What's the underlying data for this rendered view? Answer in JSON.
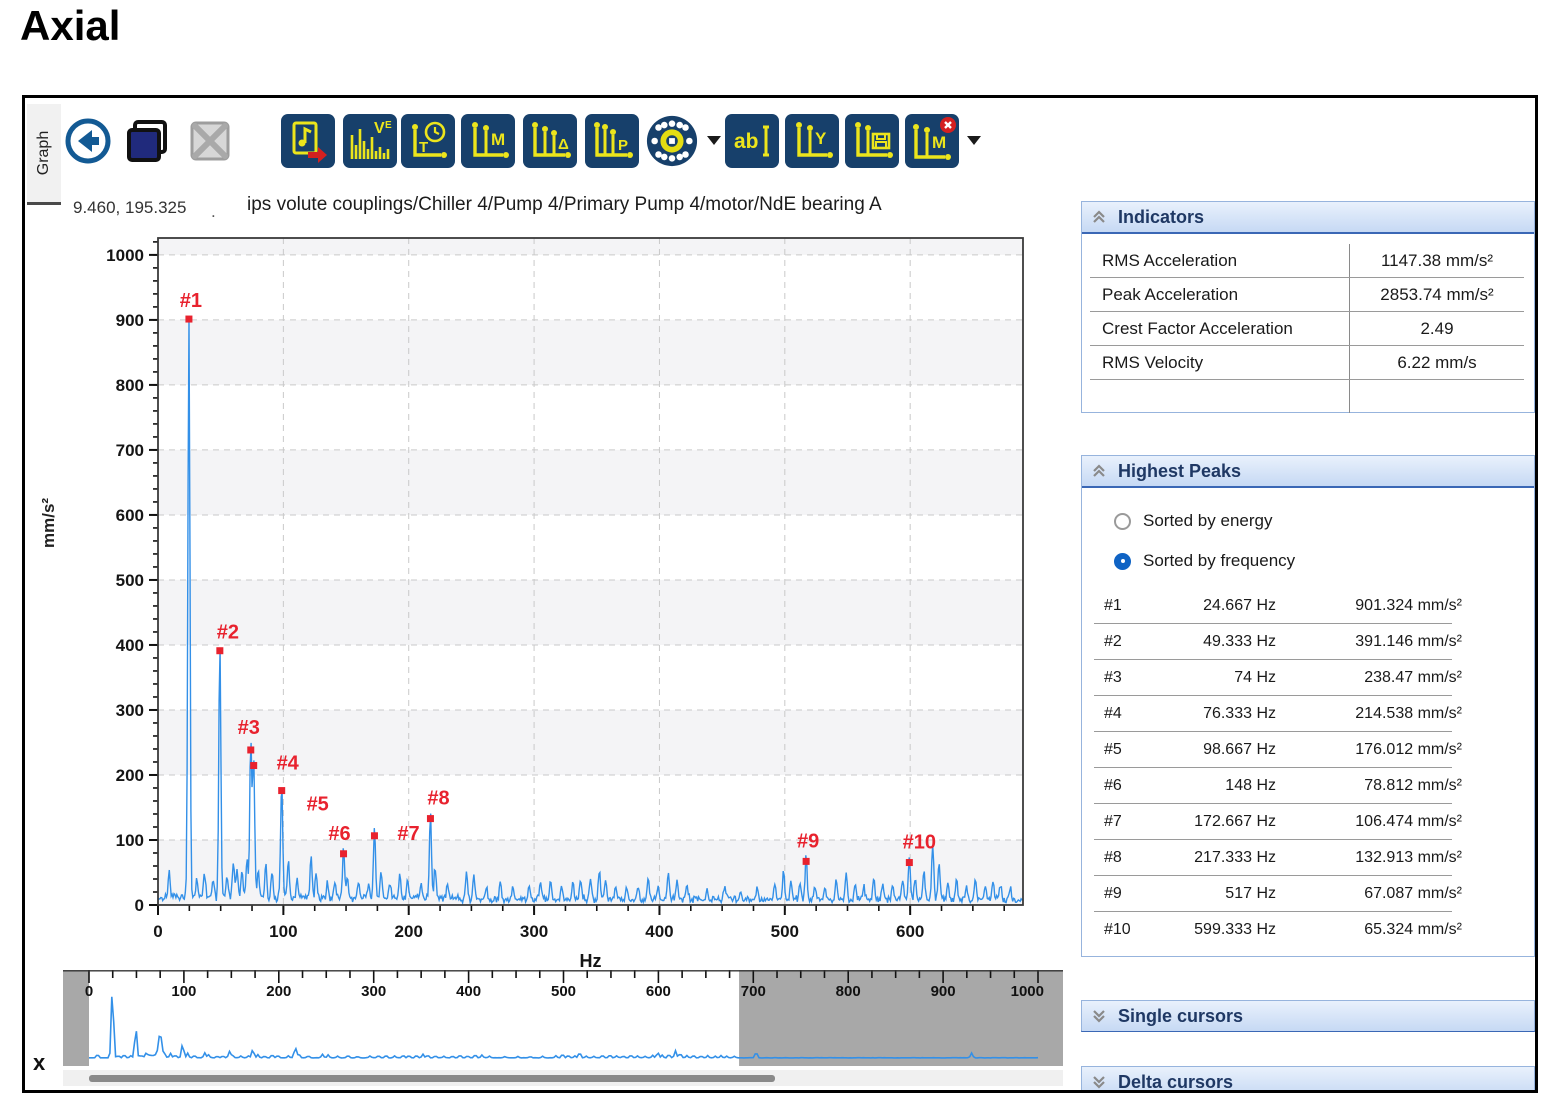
{
  "page_title": "Axial",
  "tab_label": "Graph",
  "toolbar": {
    "glyphs": {
      "ve": "V",
      "ve_sup": "E",
      "t": "T",
      "m": "M",
      "delta": "Δ",
      "p": "P",
      "ab": "ab",
      "y": "Y",
      "mx": "M"
    }
  },
  "readout": {
    "coordinates": "9.460, 195.325",
    "truncation_dot": ".",
    "path": "ips volute couplings/Chiller 4/Pump 4/Primary Pump 4/motor/NdE bearing A"
  },
  "indicators": {
    "title": "Indicators",
    "rows": [
      {
        "label": "RMS Acceleration",
        "value": "1147.38 mm/s²"
      },
      {
        "label": "Peak Acceleration",
        "value": "2853.74 mm/s²"
      },
      {
        "label": "Crest Factor Acceleration",
        "value": "2.49"
      },
      {
        "label": "RMS Velocity",
        "value": "6.22 mm/s"
      },
      {
        "label": "",
        "value": ""
      }
    ]
  },
  "highest_peaks": {
    "title": "Highest Peaks",
    "sort_options": [
      {
        "label": "Sorted by energy",
        "selected": false
      },
      {
        "label": "Sorted by frequency",
        "selected": true
      }
    ],
    "rows": [
      {
        "rank": "#1",
        "frequency": "24.667 Hz",
        "amplitude": "901.324 mm/s²"
      },
      {
        "rank": "#2",
        "frequency": "49.333 Hz",
        "amplitude": "391.146 mm/s²"
      },
      {
        "rank": "#3",
        "frequency": "74 Hz",
        "amplitude": "238.47 mm/s²"
      },
      {
        "rank": "#4",
        "frequency": "76.333 Hz",
        "amplitude": "214.538 mm/s²"
      },
      {
        "rank": "#5",
        "frequency": "98.667 Hz",
        "amplitude": "176.012 mm/s²"
      },
      {
        "rank": "#6",
        "frequency": "148 Hz",
        "amplitude": "78.812 mm/s²"
      },
      {
        "rank": "#7",
        "frequency": "172.667 Hz",
        "amplitude": "106.474 mm/s²"
      },
      {
        "rank": "#8",
        "frequency": "217.333 Hz",
        "amplitude": "132.913 mm/s²"
      },
      {
        "rank": "#9",
        "frequency": "517 Hz",
        "amplitude": "67.087 mm/s²"
      },
      {
        "rank": "#10",
        "frequency": "599.333 Hz",
        "amplitude": "65.324 mm/s²"
      }
    ]
  },
  "cursor_panels": {
    "single": "Single cursors",
    "delta": "Delta cursors"
  },
  "close_label": "x",
  "chart_data": {
    "type": "line",
    "title": "Acceleration spectrum",
    "xlabel": "Hz",
    "ylabel": "mm/s²",
    "xlim": [
      0,
      690
    ],
    "ylim": [
      0,
      1026
    ],
    "x_major_tick": 100,
    "x_minor_tick": 25,
    "y_major_tick": 100,
    "y_minor_tick": 20,
    "grid": "dashed, every 100 Hz and 100 mm/s²",
    "line_color": "#3390e8",
    "marker_color": "#e8222e",
    "peaks": [
      {
        "label": "#1",
        "hz": 24.667,
        "amp": 901.324,
        "dx": 2,
        "dy": -12
      },
      {
        "label": "#2",
        "hz": 49.333,
        "amp": 391.146,
        "dx": 8,
        "dy": -12
      },
      {
        "label": "#3",
        "hz": 74,
        "amp": 238.47,
        "dx": -2,
        "dy": -16
      },
      {
        "label": "#4",
        "hz": 76.333,
        "amp": 214.538,
        "dx": 34,
        "dy": 4
      },
      {
        "label": "#5",
        "hz": 98.667,
        "amp": 176.012,
        "dx": 36,
        "dy": 20
      },
      {
        "label": "#6",
        "hz": 148,
        "amp": 78.812,
        "dx": -4,
        "dy": -14
      },
      {
        "label": "#7",
        "hz": 172.667,
        "amp": 106.474,
        "dx": 34,
        "dy": 4
      },
      {
        "label": "#8",
        "hz": 217.333,
        "amp": 132.913,
        "dx": 8,
        "dy": -14
      },
      {
        "label": "#9",
        "hz": 517,
        "amp": 67.087,
        "dx": 2,
        "dy": -14
      },
      {
        "label": "#10",
        "hz": 599.333,
        "amp": 65.324,
        "dx": 10,
        "dy": -14
      }
    ],
    "minor_peaks": [
      [
        9,
        42
      ],
      [
        31,
        28
      ],
      [
        37,
        38
      ],
      [
        44,
        26
      ],
      [
        55,
        34
      ],
      [
        60,
        55
      ],
      [
        63,
        45
      ],
      [
        67,
        40
      ],
      [
        71,
        58
      ],
      [
        80,
        46
      ],
      [
        86,
        54
      ],
      [
        91,
        36
      ],
      [
        104,
        58
      ],
      [
        111,
        30
      ],
      [
        122,
        62
      ],
      [
        126,
        38
      ],
      [
        135,
        20
      ],
      [
        141,
        24
      ],
      [
        151,
        34
      ],
      [
        160,
        22
      ],
      [
        168,
        24
      ],
      [
        178,
        40
      ],
      [
        185,
        20
      ],
      [
        193,
        38
      ],
      [
        199,
        28
      ],
      [
        210,
        24
      ],
      [
        221,
        48
      ],
      [
        231,
        24
      ],
      [
        246,
        44
      ],
      [
        252,
        38
      ],
      [
        262,
        20
      ],
      [
        273,
        28
      ],
      [
        283,
        18
      ],
      [
        296,
        22
      ],
      [
        305,
        28
      ],
      [
        313,
        30
      ],
      [
        322,
        24
      ],
      [
        331,
        32
      ],
      [
        337,
        28
      ],
      [
        345,
        30
      ],
      [
        352,
        46
      ],
      [
        357,
        34
      ],
      [
        365,
        24
      ],
      [
        374,
        20
      ],
      [
        383,
        22
      ],
      [
        391,
        34
      ],
      [
        399,
        24
      ],
      [
        407,
        40
      ],
      [
        414,
        34
      ],
      [
        422,
        20
      ],
      [
        438,
        15
      ],
      [
        452,
        18
      ],
      [
        465,
        15
      ],
      [
        478,
        20
      ],
      [
        492,
        24
      ],
      [
        499,
        46
      ],
      [
        505,
        30
      ],
      [
        512,
        24
      ],
      [
        524,
        22
      ],
      [
        532,
        18
      ],
      [
        541,
        30
      ],
      [
        549,
        38
      ],
      [
        556,
        24
      ],
      [
        563,
        22
      ],
      [
        571,
        34
      ],
      [
        578,
        24
      ],
      [
        586,
        20
      ],
      [
        594,
        30
      ],
      [
        604,
        34
      ],
      [
        611,
        42
      ],
      [
        618,
        88
      ],
      [
        623,
        55
      ],
      [
        630,
        28
      ],
      [
        637,
        30
      ],
      [
        645,
        22
      ],
      [
        652,
        28
      ],
      [
        660,
        20
      ],
      [
        666,
        28
      ],
      [
        672,
        22
      ],
      [
        680,
        18
      ]
    ]
  },
  "overview": {
    "xlim": [
      0,
      1000
    ],
    "tick_major": 100,
    "tick_minor": 25,
    "visible_range": [
      0,
      685
    ],
    "extra_peaks": [
      [
        703,
        70
      ],
      [
        930,
        60
      ]
    ],
    "shade_color": "#a8a8a8"
  }
}
